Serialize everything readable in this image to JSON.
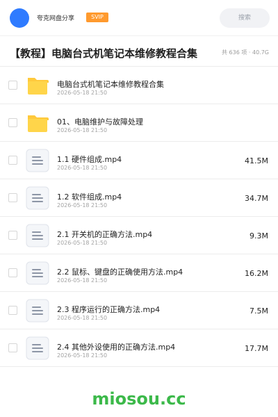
{
  "header": {
    "uploader_name": "夸克网盘分享",
    "badge": "SVIP",
    "search_placeholder": "搜索",
    "accent_color": "#2f7bff",
    "badge_color": "#ff9a2e"
  },
  "share": {
    "title": "【教程】电脑台式机笔记本维修教程合集",
    "meta": "共 636 项 · 40.7G"
  },
  "items": [
    {
      "type": "folder",
      "icon": "folder-icon",
      "name": "电脑台式机笔记本维修教程合集",
      "date": "2026-05-18 21:50",
      "size": ""
    },
    {
      "type": "folder",
      "icon": "folder-icon",
      "name": "01、电脑维护与故障处理",
      "date": "2026-05-18 21:50",
      "size": ""
    },
    {
      "type": "file",
      "icon": "document-icon",
      "name": "1.1  硬件组成.mp4",
      "date": "2026-05-18 21:50",
      "size": "41.5M"
    },
    {
      "type": "file",
      "icon": "document-icon",
      "name": "1.2  软件组成.mp4",
      "date": "2026-05-18 21:50",
      "size": "34.7M"
    },
    {
      "type": "file",
      "icon": "document-icon",
      "name": "2.1  开关机的正确方法.mp4",
      "date": "2026-05-18 21:50",
      "size": "9.3M"
    },
    {
      "type": "file",
      "icon": "document-icon",
      "name": "2.2  鼠标、键盘的正确使用方法.mp4",
      "date": "2026-05-18 21:50",
      "size": "16.2M"
    },
    {
      "type": "file",
      "icon": "document-icon",
      "name": "2.3  程序运行的正确方法.mp4",
      "date": "2026-05-18 21:50",
      "size": "7.5M"
    },
    {
      "type": "file",
      "icon": "document-icon",
      "name": "2.4  其他外设使用的正确方法.mp4",
      "date": "2026-05-18 21:50",
      "size": "17.7M"
    }
  ],
  "watermark": "miosou.cc"
}
